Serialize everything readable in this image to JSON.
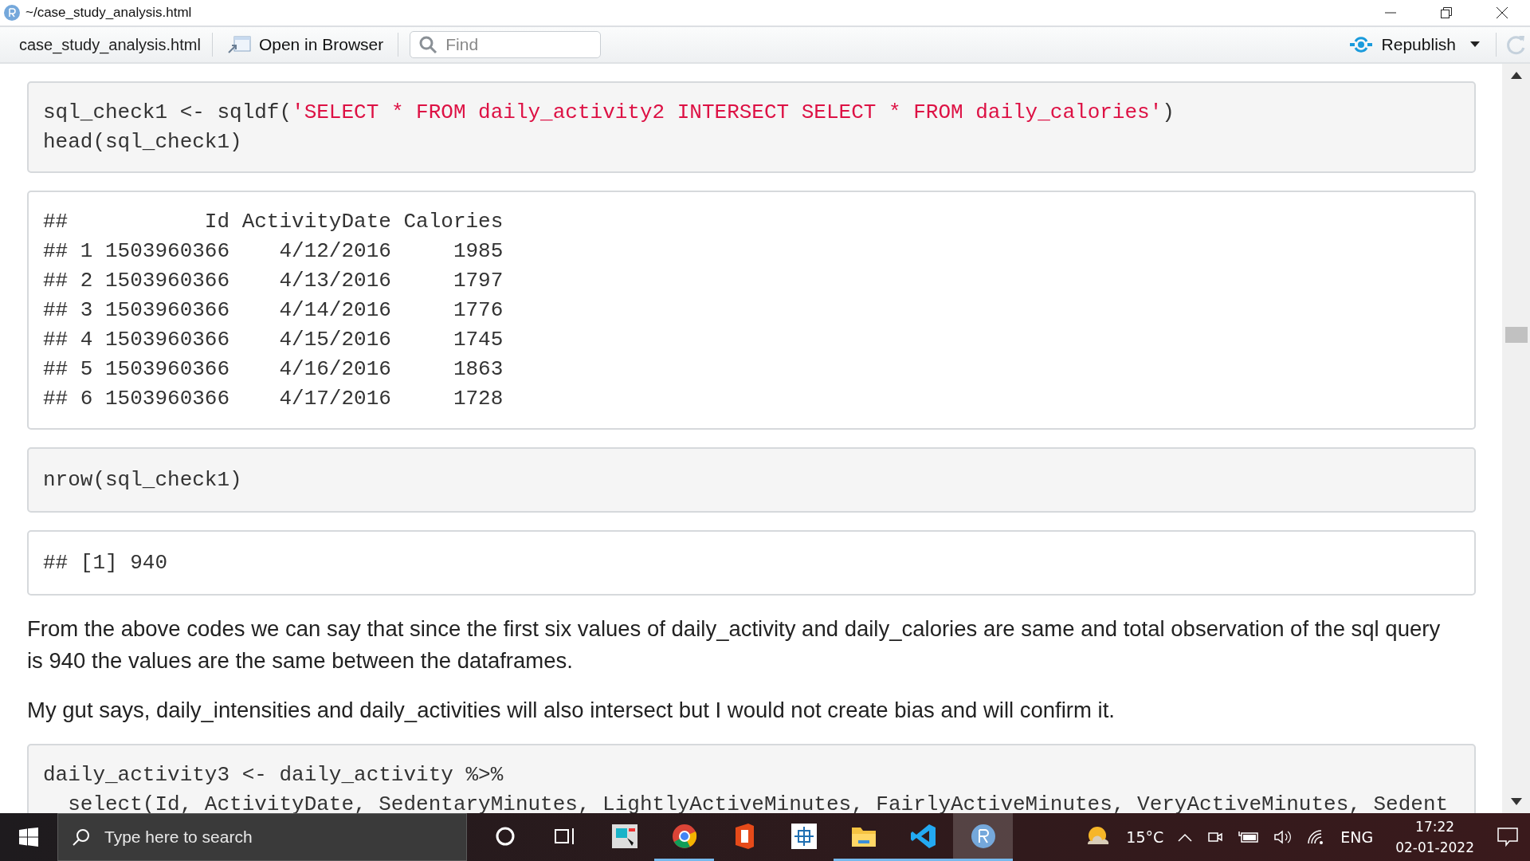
{
  "window": {
    "title": "~/case_study_analysis.html"
  },
  "toolbar": {
    "file_label": "case_study_analysis.html",
    "open_button": "Open in Browser",
    "find": {
      "placeholder": "Find"
    },
    "republish_button": "Republish"
  },
  "document": [
    {
      "kind": "code",
      "lines": [
        [
          {
            "kind": "plain",
            "text": "sql_check1 <- sqldf("
          },
          {
            "kind": "string",
            "text": "'SELECT * FROM daily_activity2 INTERSECT SELECT * FROM daily_calories'"
          },
          {
            "kind": "plain",
            "text": ")"
          }
        ],
        [
          {
            "kind": "plain",
            "text": "head(sql_check1)"
          }
        ]
      ]
    },
    {
      "kind": "output",
      "lines": [
        "##           Id ActivityDate Calories",
        "## 1 1503960366    4/12/2016     1985",
        "## 2 1503960366    4/13/2016     1797",
        "## 3 1503960366    4/14/2016     1776",
        "## 4 1503960366    4/15/2016     1745",
        "## 5 1503960366    4/16/2016     1863",
        "## 6 1503960366    4/17/2016     1728"
      ]
    },
    {
      "kind": "code",
      "lines": [
        [
          {
            "kind": "plain",
            "text": "nrow(sql_check1)"
          }
        ]
      ]
    },
    {
      "kind": "output",
      "lines": [
        "## [1] 940"
      ]
    },
    {
      "kind": "paragraph",
      "text": "From the above codes we can say that since the first six values of daily_activity and daily_calories are same and total observation of the sql query is 940 the values are the same between the dataframes."
    },
    {
      "kind": "paragraph",
      "text": "My gut says, daily_intensities and daily_activities will also intersect but I would not create bias and will confirm it."
    },
    {
      "kind": "code",
      "lines": [
        [
          {
            "kind": "plain",
            "text": "daily_activity3 <- daily_activity %>%"
          }
        ],
        [
          {
            "kind": "plain",
            "text": "  select(Id, ActivityDate, SedentaryMinutes, LightlyActiveMinutes, FairlyActiveMinutes, VeryActiveMinutes, Sedent"
          }
        ]
      ]
    }
  ],
  "taskbar": {
    "search": {
      "placeholder": "Type here to search"
    },
    "apps": [
      {
        "kind": "cortana",
        "running": false,
        "selected": false
      },
      {
        "kind": "taskview",
        "running": false,
        "selected": false
      },
      {
        "kind": "screen",
        "running": false,
        "selected": false
      },
      {
        "kind": "chrome",
        "running": true,
        "selected": false
      },
      {
        "kind": "office",
        "running": false,
        "selected": false
      },
      {
        "kind": "grid",
        "running": false,
        "selected": false
      },
      {
        "kind": "folder",
        "running": true,
        "selected": false
      },
      {
        "kind": "vscode",
        "running": true,
        "selected": false
      },
      {
        "kind": "r",
        "running": true,
        "selected": true
      }
    ],
    "temperature": "15°C",
    "language": "ENG",
    "time": "17:22",
    "date": "02-01-2022"
  }
}
